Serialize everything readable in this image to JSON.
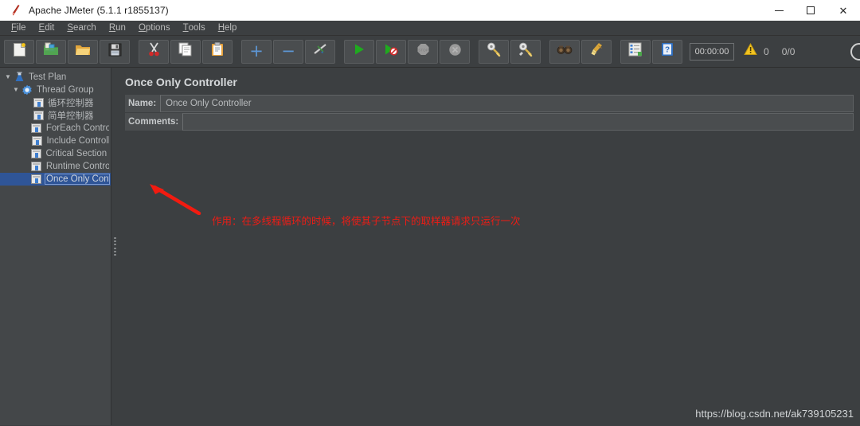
{
  "window": {
    "title": "Apache JMeter (5.1.1 r1855137)",
    "app_icon": "jmeter-feather-icon",
    "controls": {
      "minimize": "minimize-icon",
      "maximize": "maximize-icon",
      "close": "close-icon"
    }
  },
  "menubar": {
    "items": [
      {
        "label": "File",
        "mnemonic": "F"
      },
      {
        "label": "Edit",
        "mnemonic": "E"
      },
      {
        "label": "Search",
        "mnemonic": "S"
      },
      {
        "label": "Run",
        "mnemonic": "R"
      },
      {
        "label": "Options",
        "mnemonic": "O"
      },
      {
        "label": "Tools",
        "mnemonic": "T"
      },
      {
        "label": "Help",
        "mnemonic": "H"
      }
    ]
  },
  "toolbar": {
    "buttons": [
      {
        "name": "new-icon"
      },
      {
        "name": "templates-icon"
      },
      {
        "name": "open-icon"
      },
      {
        "name": "save-icon"
      },
      {
        "name": "cut-icon"
      },
      {
        "name": "copy-icon"
      },
      {
        "name": "paste-icon"
      },
      {
        "name": "expand-add-icon"
      },
      {
        "name": "collapse-remove-icon"
      },
      {
        "name": "toggle-icon"
      },
      {
        "name": "start-icon"
      },
      {
        "name": "start-no-timers-icon"
      },
      {
        "name": "stop-icon"
      },
      {
        "name": "shutdown-icon"
      },
      {
        "name": "clear-icon"
      },
      {
        "name": "clear-all-icon"
      },
      {
        "name": "search-icon"
      },
      {
        "name": "reset-search-icon"
      },
      {
        "name": "function-helper-icon"
      },
      {
        "name": "help-icon"
      }
    ],
    "timer": "00:00:00",
    "warning_icon": "warning-icon",
    "warning_count": "0",
    "thread_count": "0/0"
  },
  "sidebar": {
    "tree": [
      {
        "label": "Test Plan",
        "icon": "test-plan-icon",
        "indent": 0,
        "twisty": "▼",
        "selected": false
      },
      {
        "label": "Thread Group",
        "icon": "thread-group-icon",
        "indent": 1,
        "twisty": "▼",
        "selected": false
      },
      {
        "label": "循环控制器",
        "icon": "controller-icon",
        "indent": 2,
        "twisty": "",
        "selected": false
      },
      {
        "label": "简单控制器",
        "icon": "controller-icon",
        "indent": 2,
        "twisty": "",
        "selected": false
      },
      {
        "label": "ForEach Controller",
        "icon": "controller-icon",
        "indent": 2,
        "twisty": "",
        "selected": false
      },
      {
        "label": "Include Controller",
        "icon": "controller-icon",
        "indent": 2,
        "twisty": "",
        "selected": false
      },
      {
        "label": "Critical Section Con",
        "icon": "controller-icon",
        "indent": 2,
        "twisty": "",
        "selected": false
      },
      {
        "label": "Runtime Controller",
        "icon": "controller-icon",
        "indent": 2,
        "twisty": "",
        "selected": false
      },
      {
        "label": "Once Only Controlle",
        "icon": "controller-icon",
        "indent": 2,
        "twisty": "",
        "selected": true
      }
    ]
  },
  "panel": {
    "title": "Once Only Controller",
    "name_label": "Name:",
    "name_value": "Once Only Controller",
    "comments_label": "Comments:",
    "comments_value": ""
  },
  "annotation": {
    "text": "作用：在多线程循环的时候，将使其子节点下的取样器请求只运行一次",
    "color": "#ee1c15",
    "arrow": "red-arrow-icon"
  },
  "watermark": {
    "text": "https://blog.csdn.net/ak739105231"
  },
  "colors": {
    "window_bg": "#3c3f41",
    "sidebar_bg": "#444749",
    "selection": "#2f5597",
    "accent_blue": "#5d96d4",
    "annotation_red": "#ee1c15"
  }
}
